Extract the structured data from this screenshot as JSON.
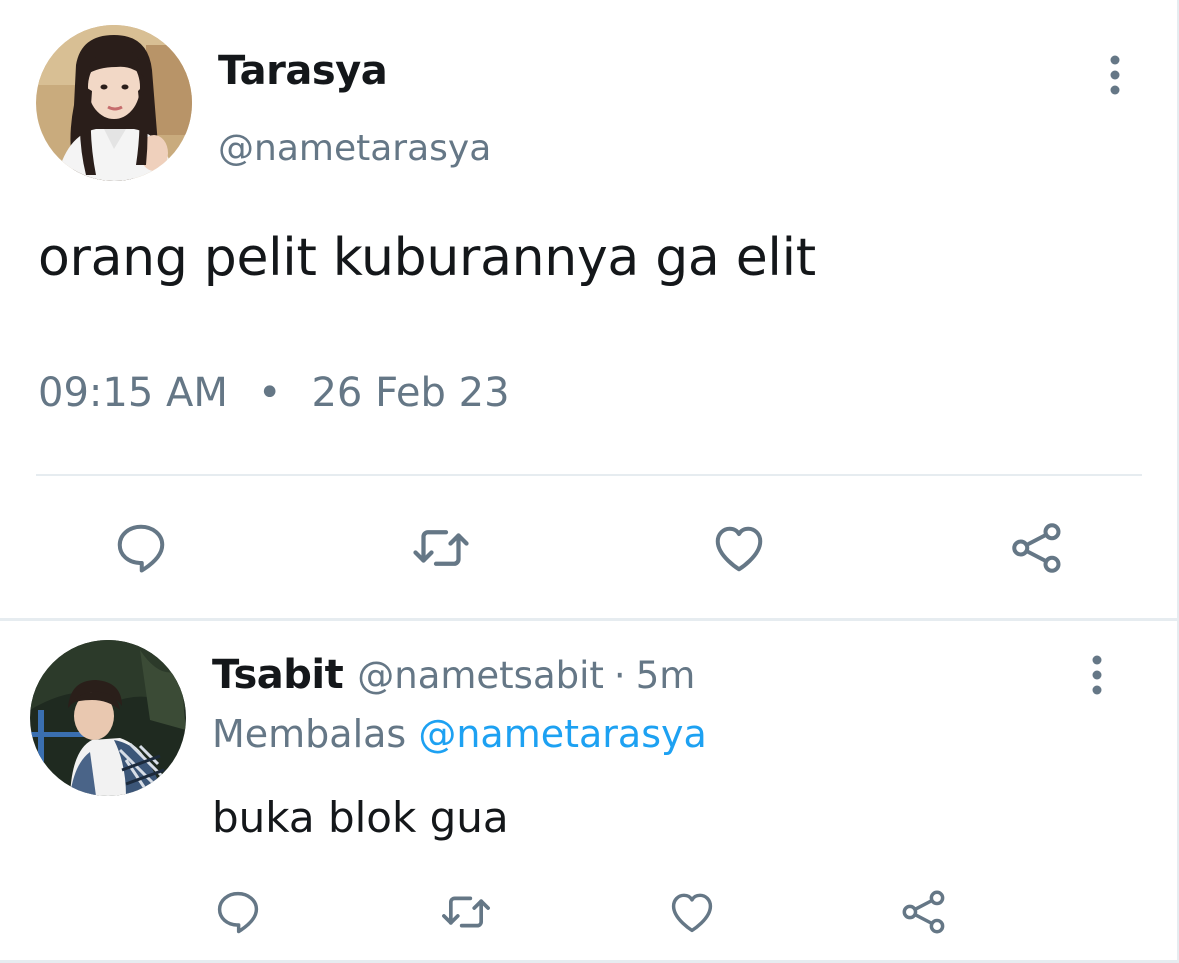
{
  "main_tweet": {
    "author_name": "Tarasya",
    "author_handle": "@nametarasya",
    "text": "orang pelit kuburannya ga elit",
    "time": "09:15 AM",
    "separator": "•",
    "date": "26 Feb 23",
    "avatar_icon": "avatar-photo-woman",
    "actions": [
      "reply-icon",
      "retweet-icon",
      "like-icon",
      "share-icon"
    ]
  },
  "reply_tweet": {
    "author_name": "Tsabit",
    "author_handle": "@nametsabit",
    "separator": "·",
    "time_ago": "5m",
    "replying_prefix": "Membalas",
    "replying_to": "@nametarasya",
    "text": "buka blok gua",
    "avatar_icon": "avatar-photo-man",
    "actions": [
      "reply-icon",
      "retweet-icon",
      "like-icon",
      "share-icon"
    ]
  },
  "colors": {
    "text_primary": "#14171a",
    "text_secondary": "#657786",
    "link": "#1da1f2",
    "divider": "#e6ecf0"
  }
}
